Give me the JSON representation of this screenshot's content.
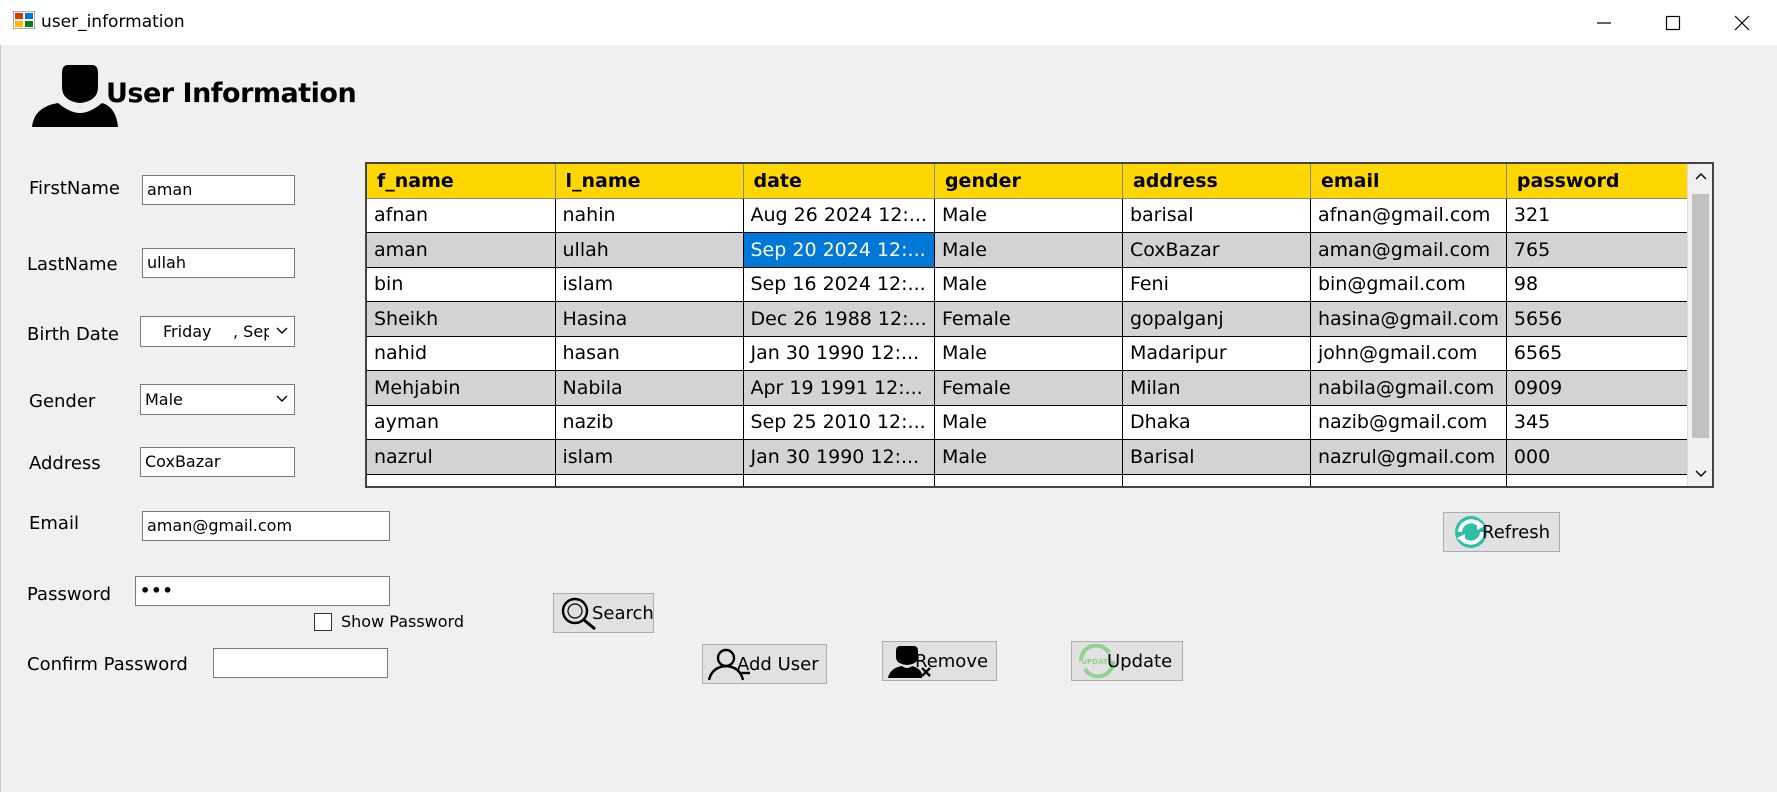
{
  "window": {
    "title": "user_information"
  },
  "header": {
    "title": "User Information"
  },
  "form": {
    "firstname_label": "FirstName",
    "firstname_value": "aman",
    "lastname_label": "LastName",
    "lastname_value": "ullah",
    "birthdate_label": "Birth Date",
    "birthdate_day": "Friday",
    "birthdate_rest": ", Sep",
    "gender_label": "Gender",
    "gender_value": "Male",
    "address_label": "Address",
    "address_value": "CoxBazar",
    "email_label": "Email",
    "email_value": "aman@gmail.com",
    "password_label": "Password",
    "password_value": "•••",
    "show_password_label": "Show Password",
    "confirm_password_label": "Confirm Password",
    "confirm_password_value": ""
  },
  "buttons": {
    "search": "Search",
    "add_user": "Add User",
    "remove": "Remove",
    "update": "Update",
    "refresh": "Refresh"
  },
  "grid": {
    "columns": [
      "f_name",
      "l_name",
      "date",
      "gender",
      "address",
      "email",
      "password"
    ],
    "selected_row": 1,
    "selected_col": 2,
    "rows": [
      [
        "afnan",
        "nahin",
        "Aug 26 2024 12:...",
        "Male",
        "barisal",
        "afnan@gmail.com",
        "321"
      ],
      [
        "aman",
        "ullah",
        "Sep 20 2024 12:...",
        "Male",
        "CoxBazar",
        "aman@gmail.com",
        "765"
      ],
      [
        "bin",
        "islam",
        "Sep 16 2024 12:...",
        "Male",
        "Feni",
        "bin@gmail.com",
        "98"
      ],
      [
        "Sheikh",
        "Hasina",
        "Dec 26 1988 12:...",
        "Female",
        "gopalganj",
        "hasina@gmail.com",
        "5656"
      ],
      [
        "nahid",
        "hasan",
        "Jan 30 1990 12:...",
        "Male",
        "Madaripur",
        "john@gmail.com",
        "6565"
      ],
      [
        "Mehjabin",
        "Nabila",
        "Apr 19 1991 12:...",
        "Female",
        "Milan",
        "nabila@gmail.com",
        "0909"
      ],
      [
        "ayman",
        "nazib",
        "Sep 25 2010 12:...",
        "Male",
        "Dhaka",
        "nazib@gmail.com",
        "345"
      ],
      [
        "nazrul",
        "islam",
        "Jan 30 1990 12:...",
        "Male",
        "Barisal",
        "nazrul@gmail.com",
        "000"
      ]
    ]
  },
  "colors": {
    "header_bg": "#ffd700",
    "alt_row": "#d3d3d3",
    "selection": "#0078d7",
    "window_bg": "#f0f0f0"
  }
}
